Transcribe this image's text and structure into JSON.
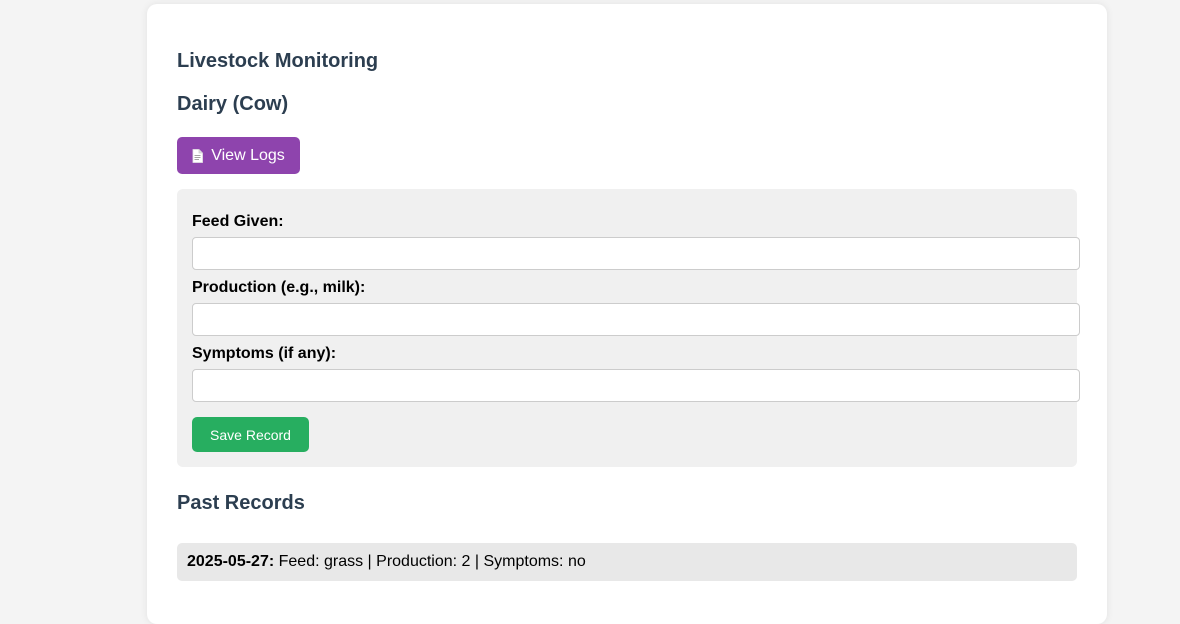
{
  "page": {
    "title": "Livestock Monitoring",
    "subtitle": "Dairy (Cow)"
  },
  "toolbar": {
    "view_logs_label": "View Logs",
    "view_logs_icon": "document-icon",
    "view_logs_color": "#8e44ad"
  },
  "form": {
    "feed_label": "Feed Given:",
    "feed_value": "",
    "production_label": "Production (e.g., milk):",
    "production_value": "",
    "symptoms_label": "Symptoms (if any):",
    "symptoms_value": "",
    "save_label": "Save Record",
    "save_color": "#27ae60"
  },
  "records": {
    "title": "Past Records",
    "items": [
      {
        "date": "2025-05-27:",
        "text": " Feed: grass | Production: 2 | Symptoms: no"
      }
    ]
  },
  "colors": {
    "heading": "#2c3e50",
    "form_background": "#f0f0f0",
    "record_background": "#e8e8e8"
  }
}
